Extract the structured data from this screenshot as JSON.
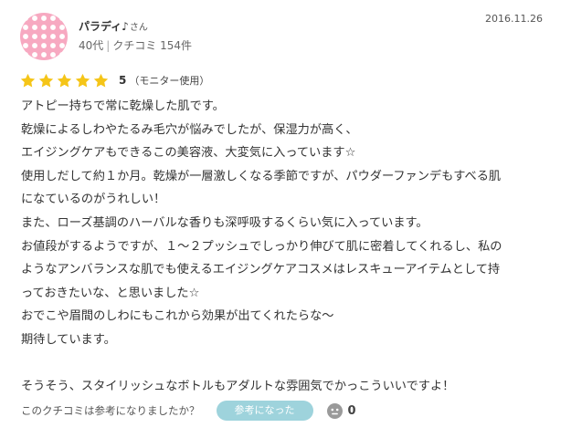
{
  "user": {
    "name": "パラディ♪",
    "suffix": "さん",
    "age": "40代",
    "review_count": "クチコミ 154件",
    "avatar_icon": "polka-dot-avatar-icon",
    "avatar_color": "#f7a9c1"
  },
  "post": {
    "date": "2016.11.26"
  },
  "rating": {
    "stars": 5,
    "max_stars": 5,
    "star_color": "#f5c518",
    "score": "5",
    "note": "（モニター使用）"
  },
  "review": {
    "lines": [
      "アトピー持ちで常に乾燥した肌です。",
      "乾燥によるしわやたるみ毛穴が悩みでしたが、保湿力が高く、",
      "エイジングケアもできるこの美容液、大変気に入っています☆",
      "使用しだして約１か月。乾燥が一層激しくなる季節ですが、パウダーファンデもすべる肌",
      "になているのがうれしい！",
      "また、ローズ基調のハーバルな香りも深呼吸するくらい気に入っています。",
      "お値段がするようですが、１～２プッシュでしっかり伸びて肌に密着してくれるし、私の",
      "ようなアンバランスな肌でも使えるエイジングケアコスメはレスキューアイテムとして持",
      "っておきたいな、と思いました☆",
      "おでこや眉間のしわにもこれから効果が出てくれたらな～",
      "期待しています。",
      "",
      "そうそう、スタイリッシュなボトルもアダルトな雰囲気でかっこういいですよ！"
    ]
  },
  "helpful": {
    "question": "このクチコミは参考になりましたか？",
    "button_label": "参考になった",
    "button_color": "#9ed3dc",
    "face_icon": "face-icon",
    "count": "0"
  }
}
